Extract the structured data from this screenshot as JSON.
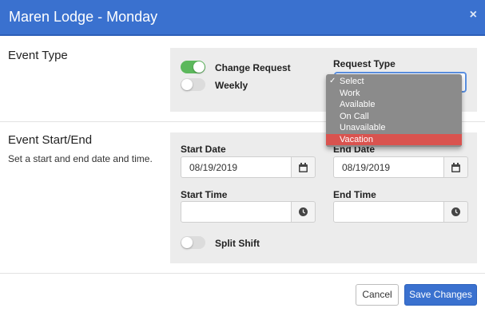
{
  "dialog": {
    "title": "Maren Lodge - Monday",
    "close_glyph": "×"
  },
  "event_type": {
    "section_label": "Event Type",
    "change_request_label": "Change Request",
    "change_request_on": true,
    "weekly_label": "Weekly",
    "weekly_on": false,
    "request_type_label": "Request Type",
    "request_type_selected": "Select",
    "request_type_options": [
      {
        "label": "Select",
        "checked": true,
        "highlighted": false
      },
      {
        "label": "Work",
        "checked": false,
        "highlighted": false
      },
      {
        "label": "Available",
        "checked": false,
        "highlighted": false
      },
      {
        "label": "On Call",
        "checked": false,
        "highlighted": false
      },
      {
        "label": "Unavailable",
        "checked": false,
        "highlighted": false
      },
      {
        "label": "Vacation",
        "checked": false,
        "highlighted": true
      }
    ]
  },
  "event_start_end": {
    "section_label": "Event Start/End",
    "description": "Set a start and end date and time.",
    "start_date_label": "Start Date",
    "start_date_value": "08/19/2019",
    "end_date_label": "End Date",
    "end_date_value": "08/19/2019",
    "start_time_label": "Start Time",
    "start_time_value": "",
    "end_time_label": "End Time",
    "end_time_value": "",
    "split_shift_label": "Split Shift",
    "split_shift_on": false
  },
  "footer": {
    "cancel_label": "Cancel",
    "save_label": "Save Changes"
  },
  "colors": {
    "header": "#3a71cf",
    "toggle_on": "#5cb85c",
    "highlight": "#d9534f",
    "panel": "#ececec"
  },
  "icons": {
    "date_picker": "calendar-icon",
    "time_picker": "clock-icon",
    "close": "close-icon"
  }
}
